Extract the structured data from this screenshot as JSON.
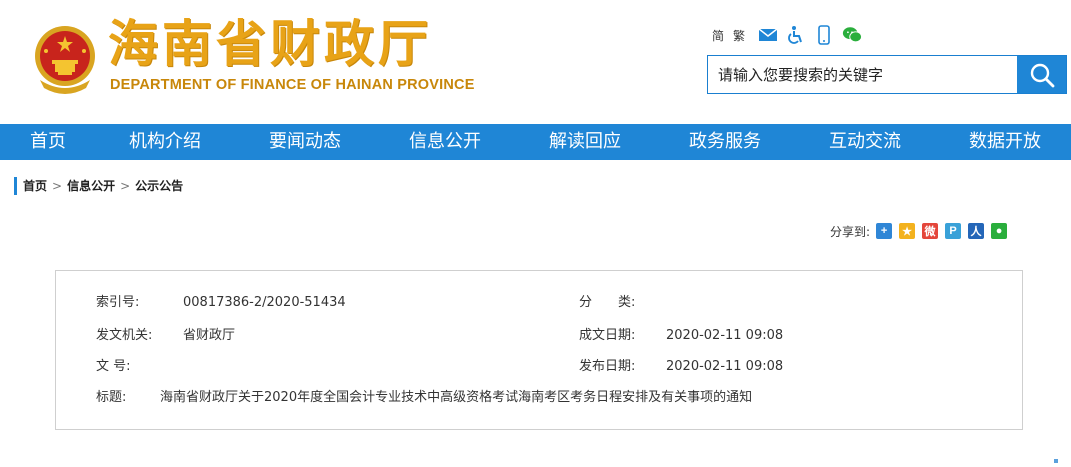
{
  "header": {
    "logo_cn": "海南省财政厅",
    "logo_en": "DEPARTMENT OF FINANCE OF HAINAN PROVINCE",
    "lang_simplified": "简",
    "lang_traditional": "繁",
    "tool_icons": [
      "mail-icon",
      "accessibility-icon",
      "mobile-icon",
      "wechat-icon"
    ]
  },
  "search": {
    "placeholder": "请输入您要搜索的关键字"
  },
  "nav": {
    "items": [
      "首页",
      "机构介绍",
      "要闻动态",
      "信息公开",
      "解读回应",
      "政务服务",
      "互动交流",
      "数据开放"
    ]
  },
  "breadcrumb": {
    "home": "首页",
    "sep": ">",
    "level1": "信息公开",
    "level2": "公示公告"
  },
  "share": {
    "label": "分享到:",
    "icons": [
      "qzone-icon",
      "qq-icon",
      "weibo-icon",
      "tencent-weibo-icon",
      "renren-icon",
      "wechat-share-icon"
    ]
  },
  "info": {
    "index_label": "索引号:",
    "index_value": "00817386-2/2020-51434",
    "category_label": "分　　类:",
    "category_value": "",
    "issuer_label": "发文机关:",
    "issuer_value": "省财政厅",
    "written_label": "成文日期:",
    "written_value": "2020-02-11 09:08",
    "docno_label": "文  号:",
    "docno_value": "",
    "published_label": "发布日期:",
    "published_value": "2020-02-11 09:08",
    "title_label": "标题:",
    "title_value": "海南省财政厅关于2020年度全国会计专业技术中高级资格考试海南考区考务日程安排及有关事项的通知"
  },
  "colors": {
    "brand_blue": "#1f86d6",
    "logo_gold": "#e8a317",
    "emblem_red": "#c8241c"
  }
}
